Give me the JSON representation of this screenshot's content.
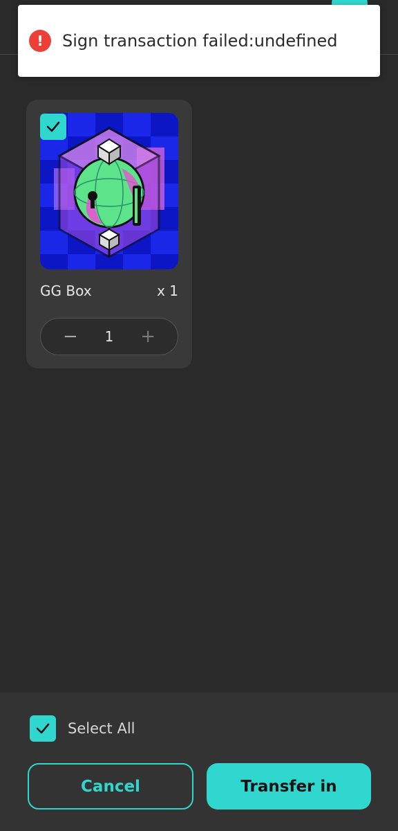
{
  "toast": {
    "message": "Sign transaction failed:undefined",
    "icon": "error-icon"
  },
  "nft": {
    "name": "GG Box",
    "count": "x 1",
    "quantity": "1",
    "selected": true,
    "image": "gg-box-artwork"
  },
  "footer": {
    "select_all_label": "Select All",
    "select_all_checked": true,
    "cancel_label": "Cancel",
    "transfer_label": "Transfer in"
  },
  "colors": {
    "accent": "#2fd7cf",
    "background": "#2a2a2a",
    "card": "#393939",
    "error": "#ec3f37"
  }
}
